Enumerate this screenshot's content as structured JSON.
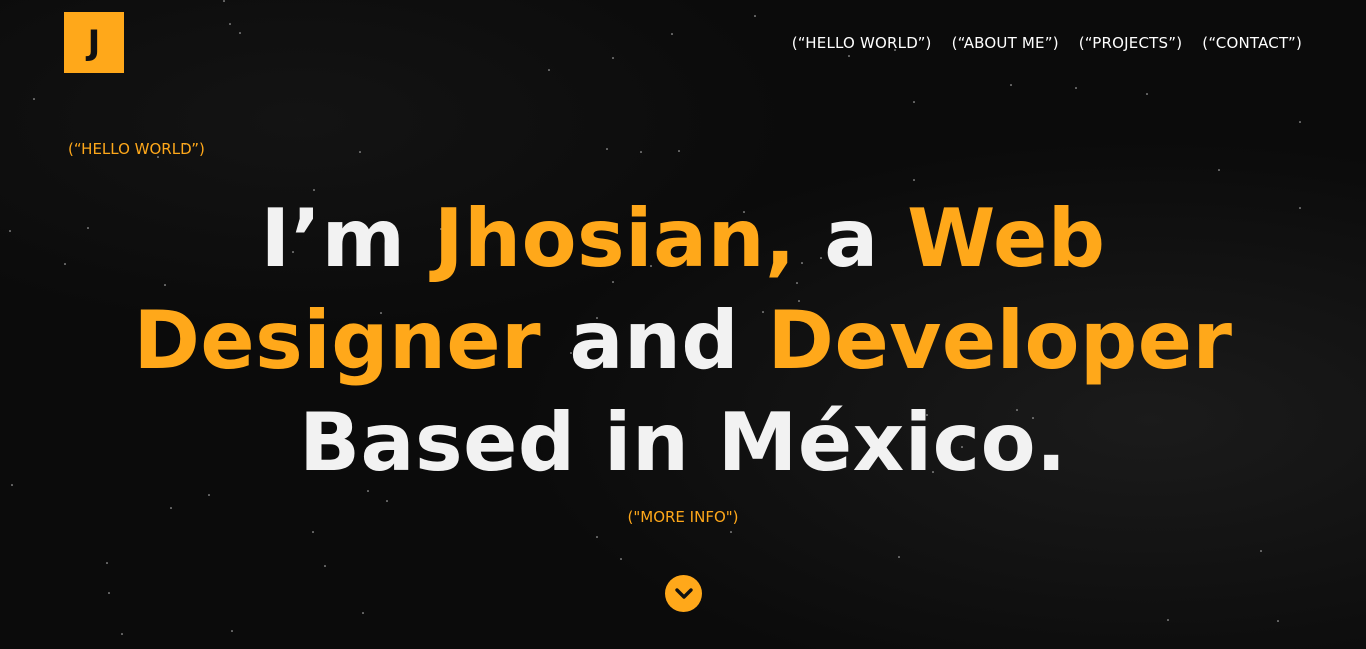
{
  "logo": {
    "letter": "J"
  },
  "nav": {
    "items": [
      {
        "label": "(“HELLO WORLD”)"
      },
      {
        "label": "(“ABOUT ME”)"
      },
      {
        "label": "(“PROJECTS”)"
      },
      {
        "label": "(“CONTACT”)"
      }
    ]
  },
  "hero": {
    "section_tag": "(“HELLO WORLD”)",
    "headline": {
      "line1": [
        "I’m ",
        "Jhosian,",
        " a ",
        "Web"
      ],
      "line2": [
        "Designer",
        " and ",
        "Developer"
      ],
      "line3": [
        "Based in México."
      ]
    },
    "more_info": "(\"MORE INFO\")",
    "scroll_icon": "chevron-down-icon"
  },
  "colors": {
    "accent": "#ffa81a",
    "background": "#0b0b0b",
    "text": "#f2f2f2"
  }
}
